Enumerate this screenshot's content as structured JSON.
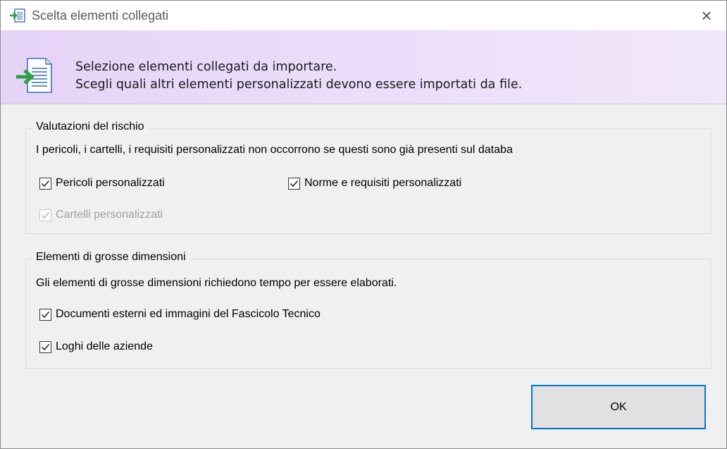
{
  "window": {
    "title": "Scelta elementi collegati",
    "close_symbol": "×"
  },
  "banner": {
    "line1": "Selezione elementi collegati da importare.",
    "line2": "Scegli quali altri elementi personalizzati devono essere importati da file.",
    "icon": "import-document-icon"
  },
  "risk_group": {
    "legend": "Valutazioni del rischio",
    "note": "I pericoli, i cartelli, i requisiti personalizzati non occorrono se questi sono già presenti sul databa",
    "items": [
      {
        "label": "Pericoli personalizzati",
        "checked": true,
        "enabled": true
      },
      {
        "label": "Norme e requisiti personalizzati",
        "checked": true,
        "enabled": true
      },
      {
        "label": "Cartelli personalizzati",
        "checked": true,
        "enabled": false
      }
    ]
  },
  "large_group": {
    "legend": "Elementi di grosse dimensioni",
    "note": "Gli elementi di grosse dimensioni richiedono tempo per essere elaborati.",
    "items": [
      {
        "label": "Documenti esterni ed immagini del Fascicolo Tecnico",
        "checked": true,
        "enabled": true
      },
      {
        "label": "Loghi delle aziende",
        "checked": true,
        "enabled": true
      }
    ]
  },
  "buttons": {
    "ok_label": "OK"
  },
  "colors": {
    "banner_start": "#e6d3f8",
    "banner_end": "#f1e7fb",
    "focus_border": "#0078d7",
    "arrow_green": "#2e9e4a"
  }
}
